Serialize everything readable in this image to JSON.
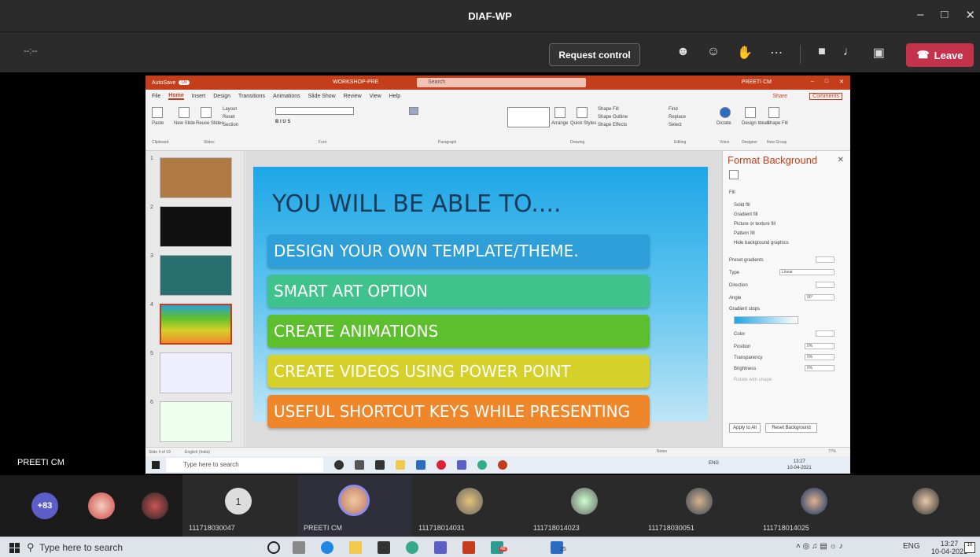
{
  "window": {
    "title": "DIAF-WP",
    "timer": "--:--"
  },
  "toolbar": {
    "request_control": "Request control",
    "leave": "Leave"
  },
  "presenter": {
    "name": "PREETI CM"
  },
  "ppt": {
    "autosave": "AutoSave",
    "autosave_state": "On",
    "file_name": "WORKSHOP-PRE",
    "search_placeholder": "Search",
    "user": "PREETI CM",
    "menu": [
      "File",
      "Home",
      "Insert",
      "Design",
      "Transitions",
      "Animations",
      "Slide Show",
      "Review",
      "View",
      "Help"
    ],
    "share": "Share",
    "comments": "Comments",
    "ribbon_groups": [
      "Clipboard",
      "Slides",
      "Font",
      "Paragraph",
      "Drawing",
      "Editing",
      "Voice",
      "Designer",
      "New Group"
    ],
    "ribbon_items": {
      "paste": "Paste",
      "new_slide": "New Slide",
      "reuse_slides": "Reuse Slides",
      "layout": "Layout",
      "reset": "Reset",
      "section": "Section",
      "arrange": "Arrange",
      "quick_styles": "Quick Styles",
      "shape_fill": "Shape Fill",
      "shape_outline": "Shape Outline",
      "shape_effects": "Shape Effects",
      "find": "Find",
      "replace": "Replace",
      "select": "Select",
      "dictate": "Dictate",
      "design_ideas": "Design Ideas",
      "shape_fill2": "Shape Fill"
    },
    "slide_numbers": [
      "1",
      "2",
      "3",
      "4",
      "5",
      "6"
    ],
    "slide": {
      "title": "YOU WILL BE ABLE TO....",
      "bullets": [
        {
          "text": "DESIGN YOUR OWN TEMPLATE/THEME.",
          "color": "#2e9fd8"
        },
        {
          "text": "SMART ART OPTION",
          "color": "#3fc28c"
        },
        {
          "text": "CREATE ANIMATIONS",
          "color": "#5dbf2e"
        },
        {
          "text": "CREATE VIDEOS USING POWER POINT",
          "color": "#d6d12a"
        },
        {
          "text": "USEFUL SHORTCUT KEYS WHILE PRESENTING",
          "color": "#f0862a"
        }
      ]
    },
    "format_pane": {
      "title": "Format Background",
      "section": "Fill",
      "options": [
        "Solid fill",
        "Gradient fill",
        "Picture or texture fill",
        "Pattern fill",
        "Hide background graphics"
      ],
      "preset_gradients": "Preset gradients",
      "type_label": "Type",
      "type_value": "Linear",
      "direction": "Direction",
      "angle_label": "Angle",
      "angle_value": "90°",
      "gradient_stops": "Gradient stops",
      "color": "Color",
      "position": "Position",
      "position_value": "0%",
      "transparency": "Transparency",
      "transparency_value": "0%",
      "brightness": "Brightness",
      "brightness_value": "0%",
      "rotate": "Rotate with shape",
      "apply_all": "Apply to All",
      "reset_bg": "Reset Background"
    },
    "status": {
      "slide_info": "Slide 4 of 19",
      "language": "English (India)",
      "notes": "Notes",
      "zoom": "77%"
    },
    "inner_taskbar": {
      "search": "Type here to search",
      "lang": "ENG",
      "time": "13:27",
      "date": "10-04-2021"
    }
  },
  "participants": [
    {
      "label": "+83",
      "name": ""
    },
    {
      "label": "1",
      "name": "111718030047"
    },
    {
      "label": "",
      "name": "PREETI CM"
    },
    {
      "label": "",
      "name": "111718014031"
    },
    {
      "label": "",
      "name": "111718014023"
    },
    {
      "label": "",
      "name": "111718030051"
    },
    {
      "label": "",
      "name": "111718014025"
    }
  ],
  "taskbar": {
    "search": "Type here to search",
    "lang": "ENG",
    "time": "13:27",
    "date": "10-04-2021",
    "notifications": "10",
    "badge_48": "48",
    "badge_25": "25"
  }
}
